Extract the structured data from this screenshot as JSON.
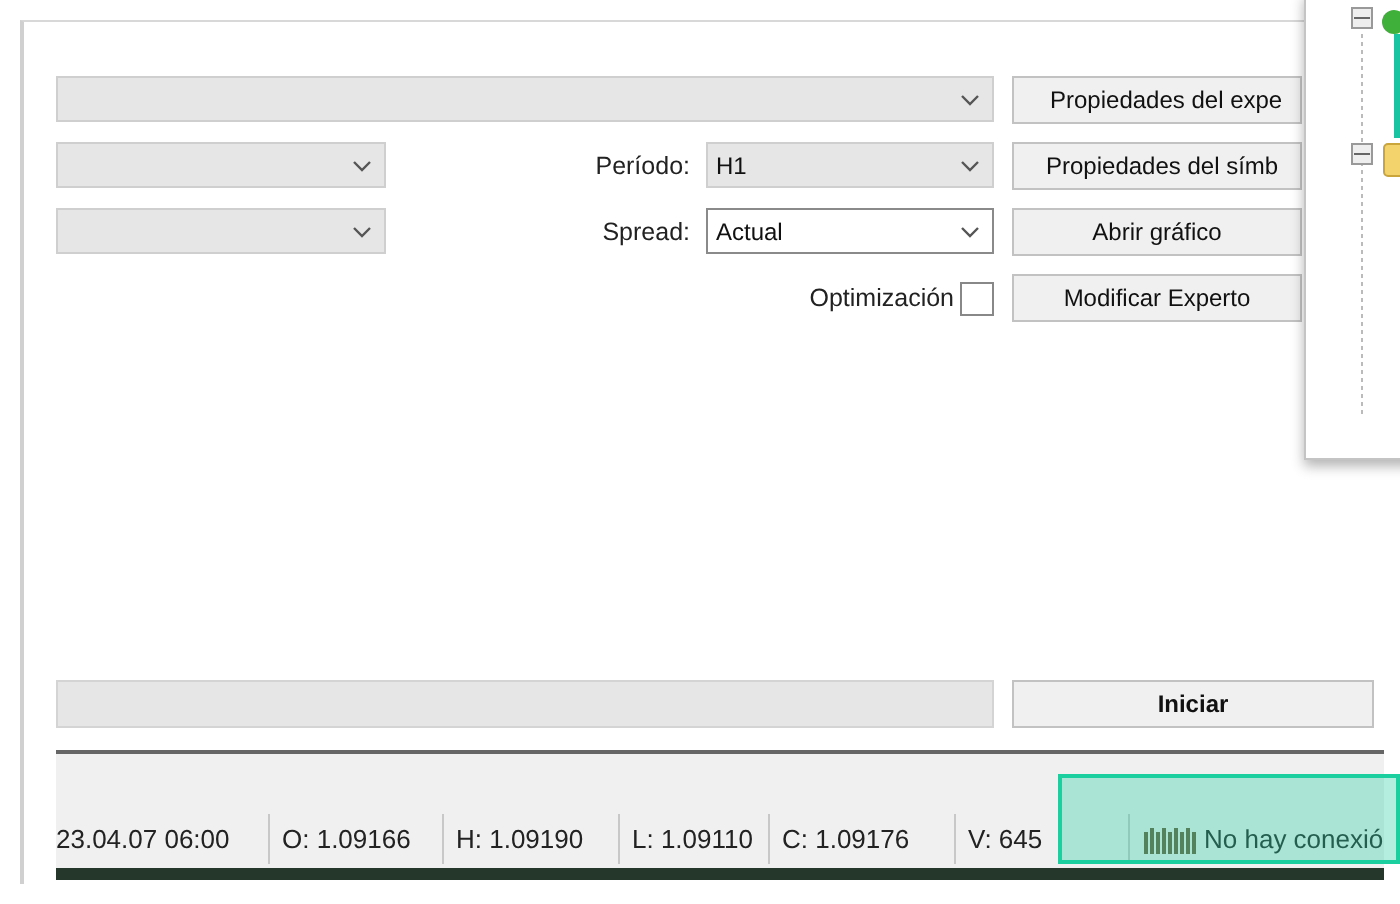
{
  "top_combo": {
    "disabled": true
  },
  "left_combos": [
    {
      "disabled": true
    },
    {
      "disabled": true
    }
  ],
  "period": {
    "label": "Período:",
    "value": "H1",
    "disabled": true
  },
  "spread": {
    "label": "Spread:",
    "value": "Actual",
    "disabled": false
  },
  "optimization": {
    "label": "Optimización",
    "checked": false
  },
  "buttons": [
    "Propiedades del expe",
    "Propiedades del símb",
    "Abrir gráfico",
    "Modificar Experto"
  ],
  "progress": {
    "level": 0
  },
  "start_button": "Iniciar",
  "status_bar": {
    "cells": [
      "23.04.07 06:00",
      "O: 1.09166",
      "H: 1.09190",
      "L: 1.09110",
      "C: 1.09176",
      "V: 645"
    ],
    "connection": {
      "text": "No hay conexió",
      "highlighted": true
    }
  },
  "navigator": {
    "nodes": [
      {
        "kind": "dot",
        "expanded": true
      },
      {
        "kind": "folder",
        "expanded": true
      }
    ]
  }
}
